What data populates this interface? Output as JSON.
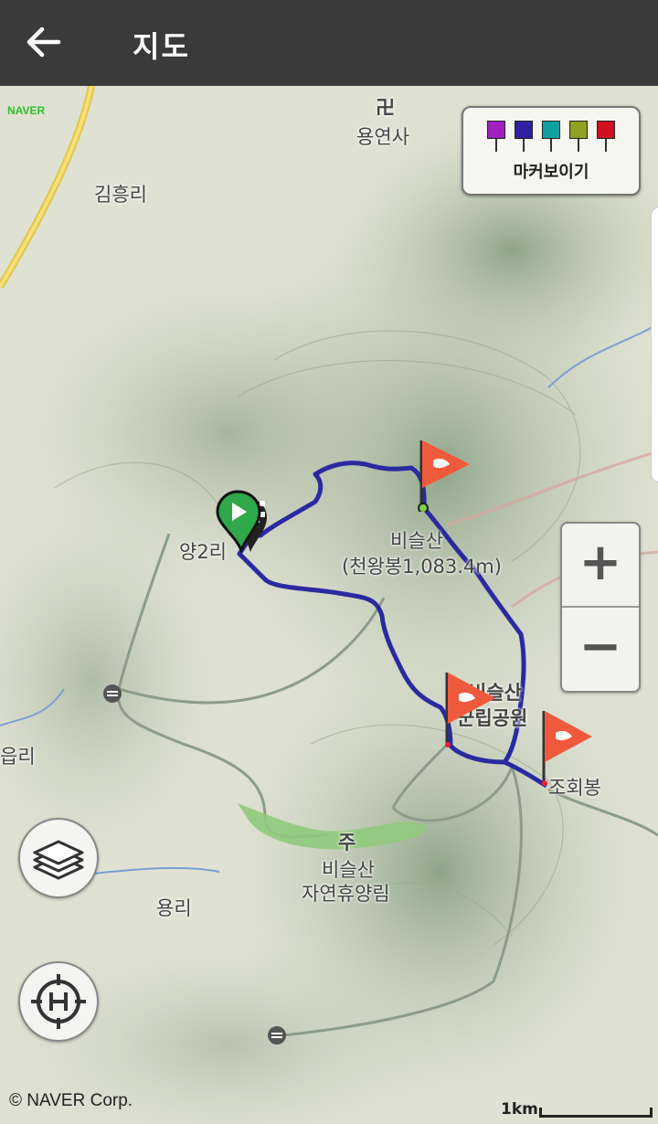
{
  "header": {
    "title": "지도"
  },
  "map": {
    "provider_logo": "NAVER",
    "labels": {
      "yongyeonsa": "용연사",
      "temple_symbol": "卍",
      "gimheungri": "김흥리",
      "yang2ri": "양2리",
      "biseulsan": "비슬산",
      "cheonwangbong": "(천왕봉1,083.4m)",
      "park1": "비슬산",
      "park2": "군립공원",
      "johoebong": "조회봉",
      "eumri": "읍리",
      "forest_symbol": "주",
      "forest1": "비슬산",
      "forest2": "자연휴양림",
      "yongri": "용리"
    },
    "copyright": "© NAVER Corp.",
    "scale_label": "1km"
  },
  "marker_panel": {
    "label": "마커보이기",
    "icons": [
      {
        "name": "camera-marker-icon",
        "color": "#a020c0"
      },
      {
        "name": "video-marker-icon",
        "color": "#3020a0"
      },
      {
        "name": "mic-marker-icon",
        "color": "#10a0a0"
      },
      {
        "name": "memo-marker-icon",
        "color": "#90a020"
      },
      {
        "name": "flag-marker-icon",
        "color": "#d01020"
      }
    ]
  },
  "zoom": {
    "in_label": "+",
    "out_label": "−"
  },
  "colors": {
    "track": "#2a2aa0",
    "flag": "#f05a3c",
    "start": "#2ea84a"
  }
}
